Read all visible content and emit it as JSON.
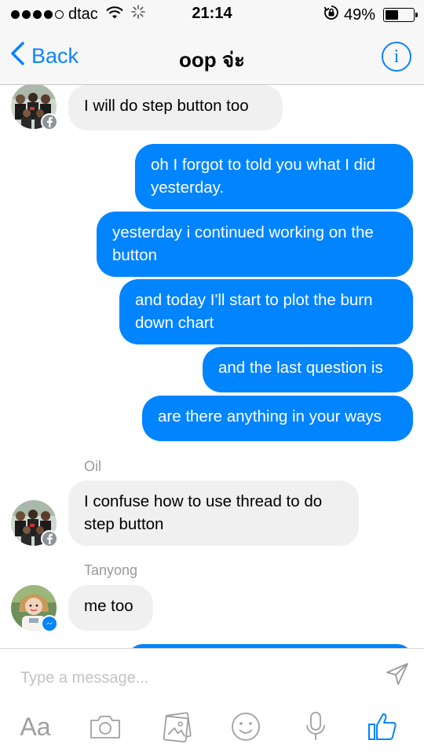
{
  "status_bar": {
    "carrier": "dtac",
    "time": "21:14",
    "battery_percent_label": "49%",
    "battery_level": 0.49
  },
  "nav": {
    "back_label": "Back",
    "title": "oop จ่ะ",
    "info_label": "i"
  },
  "messages": [
    {
      "direction": "incoming",
      "text": "I will do step button too"
    },
    {
      "direction": "outgoing",
      "text": "oh I forgot to told you what I did yesterday."
    },
    {
      "direction": "outgoing",
      "text": "yesterday i continued working on the button"
    },
    {
      "direction": "outgoing",
      "text": "and today I'll start to plot the burn down chart"
    },
    {
      "direction": "outgoing",
      "text": "and the last question is"
    },
    {
      "direction": "outgoing",
      "text": "are there anything in your ways"
    },
    {
      "direction": "incoming",
      "sender": "Oil",
      "text": "I confuse how to use thread to do step button"
    },
    {
      "direction": "incoming",
      "sender": "Tanyong",
      "text": "me too"
    }
  ],
  "composer": {
    "placeholder": "Type a message...",
    "aa_label": "Aa"
  },
  "colors": {
    "accent": "#0a84ff",
    "outgoing_bubble": "#0084ff",
    "incoming_bubble": "#f0f0f0"
  },
  "icons": [
    "back-chevron-icon",
    "info-icon",
    "send-icon",
    "camera-icon",
    "gallery-icon",
    "emoji-icon",
    "microphone-icon",
    "like-icon"
  ]
}
